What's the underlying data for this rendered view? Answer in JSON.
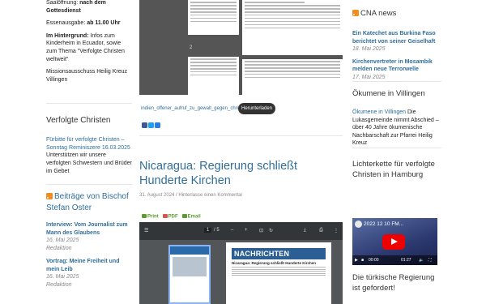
{
  "left": {
    "top_lines": [
      {
        "a": "Saalöffnung: ",
        "b": "nach dem"
      },
      {
        "a": "",
        "b": "Gottesdienst"
      }
    ],
    "essen": {
      "a": "Essenausgabe: ",
      "b": "ab 11.00 Uhr"
    },
    "hint": {
      "b": "Im Hintergrund:",
      "a": " Infos zum Kinderheim in Ecuador, sowie zum Thema \"Verfolgte Christen weltweit\""
    },
    "sign": "Missionsausschuss Heilig Kreuz Villingen",
    "widget1_title": "Verfolgte Christen",
    "widget1_link": "Fürbitte für verfolgte Christen – Sonntag Reminiszere 16.03.2025",
    "widget1_text": "Unterstützen wir unsere verfolgten Schwestern und Brüder im Gebet",
    "widget2_title": "Beiträge von Bischof Stefan Oster",
    "items": [
      {
        "title": "Interview: Vom Journalist zum Mann des Glaubens",
        "date": "16. Mai 2025",
        "author": "Redaktion"
      },
      {
        "title": "Vortrag: Meine Freiheit und mein Leib",
        "date": "16. Mai 2025",
        "author": "Redaktion"
      }
    ]
  },
  "main": {
    "page_label": "2",
    "file_link": "indien_offener_aufruf_zu_gewalt_gegen_christen",
    "download": "Herunterladen",
    "post_title": "Nicaragua: Regierung schließt Hunderte Kirchen",
    "post_meta": "31. August 2024 / Hinterlasse einen Kommentar",
    "pfe": {
      "print": "Print",
      "pdf": "PDF",
      "email": "Email"
    },
    "pdf_toolbar": {
      "page": "1",
      "of": "/ 5",
      "zoom_minus": "–",
      "zoom_plus": "+"
    },
    "news_header": "NACHRICHTEN",
    "news_sub": "Nicaragua: Regierung schließt Hunderte Kirchen"
  },
  "right": {
    "cna_title": "CNA news",
    "cna_items": [
      {
        "title": "Ein Katechet aus Burkina Faso berichtet von seiner Geiselhaft",
        "date": "18. Mai 2025"
      },
      {
        "title": "Kirchenvertreter in Mosambik melden neue Terrorwelle",
        "date": "17. Mai 2025"
      }
    ],
    "oekumene_title": "Ökumene in Villingen",
    "oekumene_link": "Ökumene in Villingen",
    "oekumene_text": " Die Lukasgemeinde nimmt Abschied – über 40 Jahre ökumenische Nachbarschaft zur Pfarrei Heilig Kreuz",
    "lichterkette_title": "Lichterkette für verfolgte Christen in Hamburg",
    "video_title": "2022 12 10 FM...",
    "video_time": "00:00",
    "video_duration": "01:27",
    "tuerkei_title": "Die türkische Regierung ist gefordert!"
  }
}
